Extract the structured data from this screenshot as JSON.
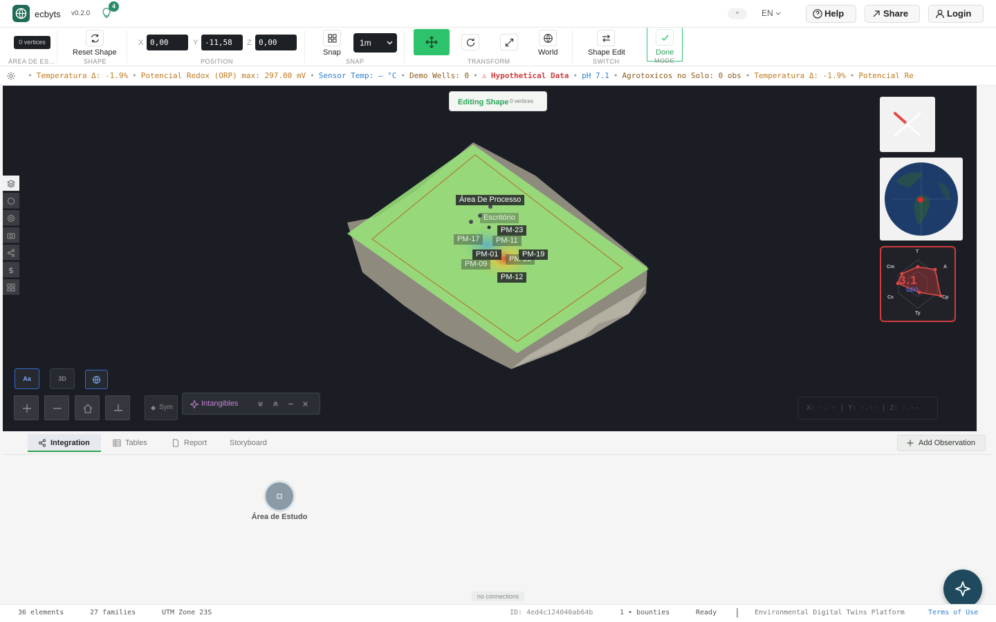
{
  "header": {
    "app_name": "ecbyts",
    "version": "v0.2.0",
    "notifications": "4",
    "collapse_glyph": "^",
    "language": "EN",
    "help_label": "Help",
    "share_label": "Share",
    "login_label": "Login"
  },
  "toolbar": {
    "vertices_badge": "0 vertices",
    "area_caption": "ÁREA DE ES...",
    "reset_label": "Reset Shape",
    "shape_caption": "SHAPE",
    "x_label": "X",
    "x_value": "0,00",
    "y_label": "Y",
    "y_value": "-11,58",
    "z_label": "Z",
    "z_value": "0,00",
    "position_caption": "POSITION",
    "snap_label": "Snap",
    "snap_value": "1m",
    "snap_caption": "SNAP",
    "transform_caption": "TRANSFORM",
    "world_label": "World",
    "shape_edit_label": "Shape Edit",
    "switch_caption": "SWITCH",
    "done_label": "Done",
    "mode_caption": "MODE"
  },
  "ticker": [
    {
      "text": "Temperatura Δ: -1.9%",
      "tone": "orange"
    },
    {
      "text": "Potencial Redox (ORP) max: 297.00 mV",
      "tone": "orange"
    },
    {
      "text": "Sensor Temp: — °C",
      "tone": "blue"
    },
    {
      "text": "Demo Wells: 0",
      "tone": "dark"
    },
    {
      "text": "⚠ Hypothetical Data",
      "tone": "red"
    },
    {
      "text": "pH 7.1",
      "tone": "blue"
    },
    {
      "text": "Agrotoxicos no Solo: 0 obs",
      "tone": "dark"
    },
    {
      "text": "Temperatura Δ: -1.9%",
      "tone": "orange"
    },
    {
      "text": "Potencial Re",
      "tone": "orange"
    }
  ],
  "viewport": {
    "editing_label": "Editing Shape",
    "editing_vertices": "0 vertices",
    "labels": {
      "area_processo": "Área De Processo",
      "escritorio": "Escritório",
      "pm23": "PM-23",
      "pm17": "PM-17",
      "pm11": "PM-11",
      "pm01": "PM-01",
      "pm22": "PM-22",
      "pm19": "PM-19",
      "pm09": "PM-09",
      "pm12": "PM-12"
    },
    "radar": {
      "score": "3.1",
      "sub": "GEO",
      "axes": [
        "T",
        "A",
        "Cp",
        "Ty",
        "Cs",
        "Cm"
      ]
    },
    "view_buttons": {
      "text_mode": "Aa",
      "three_d": "3D"
    },
    "sym_label": "Sym",
    "intangibles_label": "Intangibles",
    "coords_readout": "X: -.-- | Y: -.-- | Z: -.--"
  },
  "panel": {
    "tabs": [
      "Integration",
      "Tables",
      "Report",
      "Storyboard"
    ],
    "add_observation": "Add Observation",
    "node_label": "Área de Estudo",
    "no_connections": "no connections"
  },
  "status": {
    "elements": "36 elements",
    "families": "27 families",
    "zone": "UTM Zone 23S",
    "id": "ID: 4ed4c124040ab64b",
    "bounties": "1 • bounties",
    "ready": "Ready",
    "divider": "|",
    "platform": "Environmental Digital Twins Platform",
    "terms": "Terms of Use"
  },
  "colors": {
    "accent": "#2dc26c",
    "radar_border": "#d13c3c",
    "terms_link": "#2e7fcf"
  }
}
